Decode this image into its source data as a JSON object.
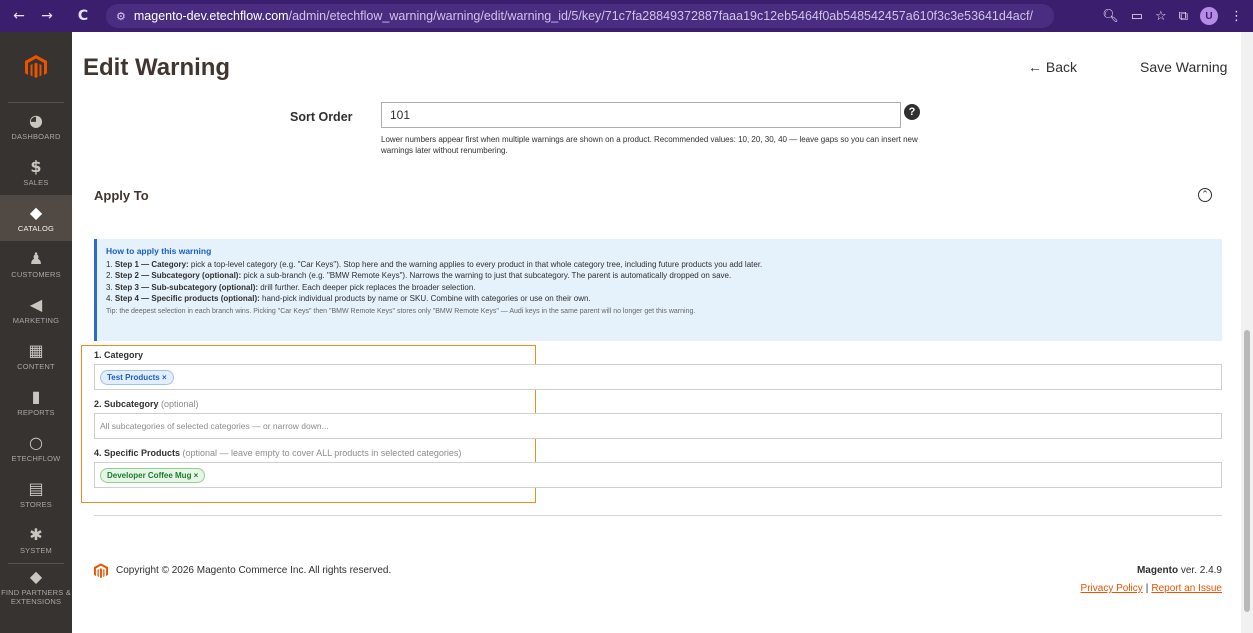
{
  "browser": {
    "back": "←",
    "forward": "→",
    "reload": "C",
    "url_host": "magento-dev.etechflow.com",
    "url_path": "/admin/etechflow_warning/warning/edit/warning_id/5/key/71c7fa28849372887faaa19c12eb5464f0ab548542457a610f3c3e53641d4acf/",
    "profile_initial": "U"
  },
  "sidebar": {
    "items": [
      {
        "label": "DASHBOARD",
        "icon": "dashboard-icon",
        "glyph": "◕"
      },
      {
        "label": "SALES",
        "icon": "dollar-icon",
        "glyph": "$"
      },
      {
        "label": "CATALOG",
        "icon": "box-icon",
        "glyph": "◆"
      },
      {
        "label": "CUSTOMERS",
        "icon": "person-icon",
        "glyph": "♟"
      },
      {
        "label": "MARKETING",
        "icon": "megaphone-icon",
        "glyph": "◀"
      },
      {
        "label": "CONTENT",
        "icon": "content-icon",
        "glyph": "▦"
      },
      {
        "label": "REPORTS",
        "icon": "bar-chart-icon",
        "glyph": "▮"
      },
      {
        "label": "ETECHFLOW",
        "icon": "circle-icon",
        "glyph": "○"
      },
      {
        "label": "STORES",
        "icon": "store-icon",
        "glyph": "▤"
      },
      {
        "label": "SYSTEM",
        "icon": "gear-icon",
        "glyph": "✱"
      },
      {
        "label": "FIND PARTNERS & EXTENSIONS",
        "icon": "partners-icon",
        "glyph": "◆"
      }
    ],
    "active_index": 2
  },
  "header": {
    "title": "Edit Warning",
    "back_label": "← Back",
    "save_label": "Save Warning"
  },
  "sort_order": {
    "label": "Sort Order",
    "value": "101",
    "help": "?",
    "note": "Lower numbers appear first when multiple warnings are shown on a product. Recommended values: 10, 20, 30, 40 — leave gaps so you can insert new warnings later without renumbering."
  },
  "apply_to": {
    "title": "Apply To",
    "info": {
      "title": "How to apply this warning",
      "steps": [
        {
          "num": "1.",
          "head": "Step 1 — Category:",
          "text": " pick a top-level category (e.g. \"Car Keys\"). Stop here and the warning applies to every product in that whole category tree, including future products you add later."
        },
        {
          "num": "2.",
          "head": "Step 2 — Subcategory (optional):",
          "text": " pick a sub-branch (e.g. \"BMW Remote Keys\"). Narrows the warning to just that subcategory. The parent is automatically dropped on save."
        },
        {
          "num": "3.",
          "head": "Step 3 — Sub-subcategory (optional):",
          "text": " drill further. Each deeper pick replaces the broader selection."
        },
        {
          "num": "4.",
          "head": "Step 4 — Specific products (optional):",
          "text": " hand-pick individual products by name or SKU. Combine with categories or use on their own."
        }
      ],
      "tip": "Tip: the deepest selection in each branch wins. Picking \"Car Keys\" then \"BMW Remote Keys\" stores only \"BMW Remote Keys\" — Audi keys in the same parent will no longer get this warning."
    },
    "category": {
      "label": "1. Category",
      "tag": "Test Products ×"
    },
    "subcategory": {
      "label": "2. Subcategory",
      "optional": " (optional)",
      "placeholder": "All subcategories of selected categories — or narrow down..."
    },
    "products": {
      "label": "4. Specific Products",
      "optional": " (optional — leave empty to cover ALL products in selected categories)",
      "tag": "Developer Coffee Mug ×"
    }
  },
  "footer": {
    "copyright": "Copyright © 2026 Magento Commerce Inc. All rights reserved.",
    "brand": "Magento",
    "version": " ver. 2.4.9",
    "privacy": "Privacy Policy",
    "separator": "|",
    "report": "Report an Issue"
  },
  "colors": {
    "browser_bar": "#3b1f6e",
    "sidebar": "#373330",
    "accent_orange": "#eb5202",
    "info_blue": "#1a5ec8",
    "highlight": "#f08a24"
  }
}
